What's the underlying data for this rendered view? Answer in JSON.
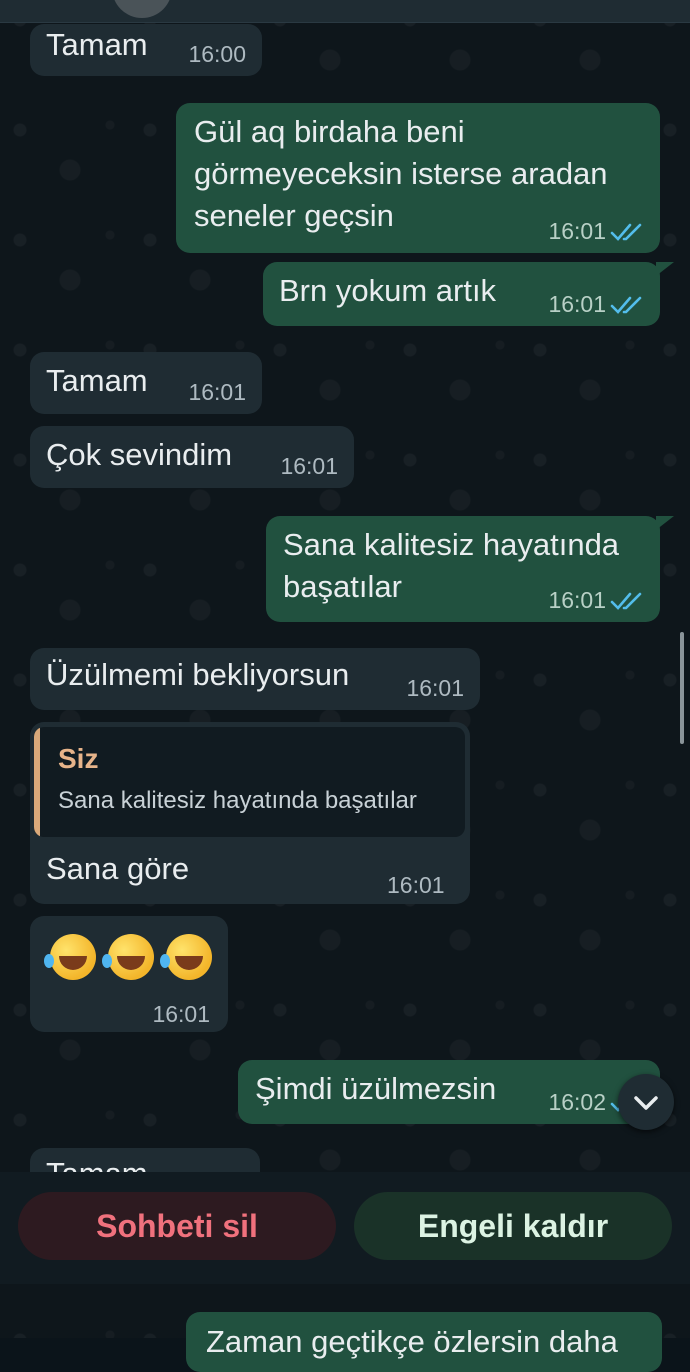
{
  "messages": [
    {
      "id": "m1",
      "dir": "in",
      "text": "Tamam",
      "time": "16:00"
    },
    {
      "id": "m2",
      "dir": "out",
      "text": "Gül aq birdaha beni\ngörmeyeceksin isterse aradan\nseneler geçsin",
      "time": "16:01",
      "status": "read"
    },
    {
      "id": "m3",
      "dir": "out",
      "text": "Brn yokum artık",
      "time": "16:01",
      "status": "read"
    },
    {
      "id": "m4",
      "dir": "in",
      "text": "Tamam",
      "time": "16:01"
    },
    {
      "id": "m5",
      "dir": "in",
      "text": "Çok sevindim",
      "time": "16:01"
    },
    {
      "id": "m6",
      "dir": "out",
      "text": "Sana kalitesiz hayatında\nbaşatılar",
      "time": "16:01",
      "status": "read"
    },
    {
      "id": "m7",
      "dir": "in",
      "text": "Üzülmemi bekliyorsun",
      "time": "16:01"
    },
    {
      "id": "m8",
      "dir": "in",
      "reply": {
        "author": "Siz",
        "text": "Sana kalitesiz hayatında başatılar"
      },
      "text": "Sana göre",
      "time": "16:01"
    },
    {
      "id": "m9",
      "dir": "in",
      "emoji": [
        "rolling-on-floor-laughing",
        "rolling-on-floor-laughing",
        "rolling-on-floor-laughing"
      ],
      "time": "16:01"
    },
    {
      "id": "m10",
      "dir": "out",
      "text": "Şimdi üzülmezsin",
      "time": "16:02",
      "status": "read"
    },
    {
      "id": "m11",
      "dir": "in",
      "text": "Tamam"
    },
    {
      "id": "m12",
      "dir": "out",
      "text": "Zaman geçtikçe özlersin daha"
    }
  ],
  "actions": {
    "delete_chat": "Sohbeti sil",
    "unblock": "Engeli kaldır"
  },
  "icons": {
    "scroll_down": "chevron-down-icon",
    "read": "double-check-icon"
  },
  "colors": {
    "incoming": "#1f2c33",
    "outgoing": "#21513f",
    "read_ticks": "#53bdeb",
    "delete": "#f0717d",
    "quote_bar": "#d9a97a"
  }
}
